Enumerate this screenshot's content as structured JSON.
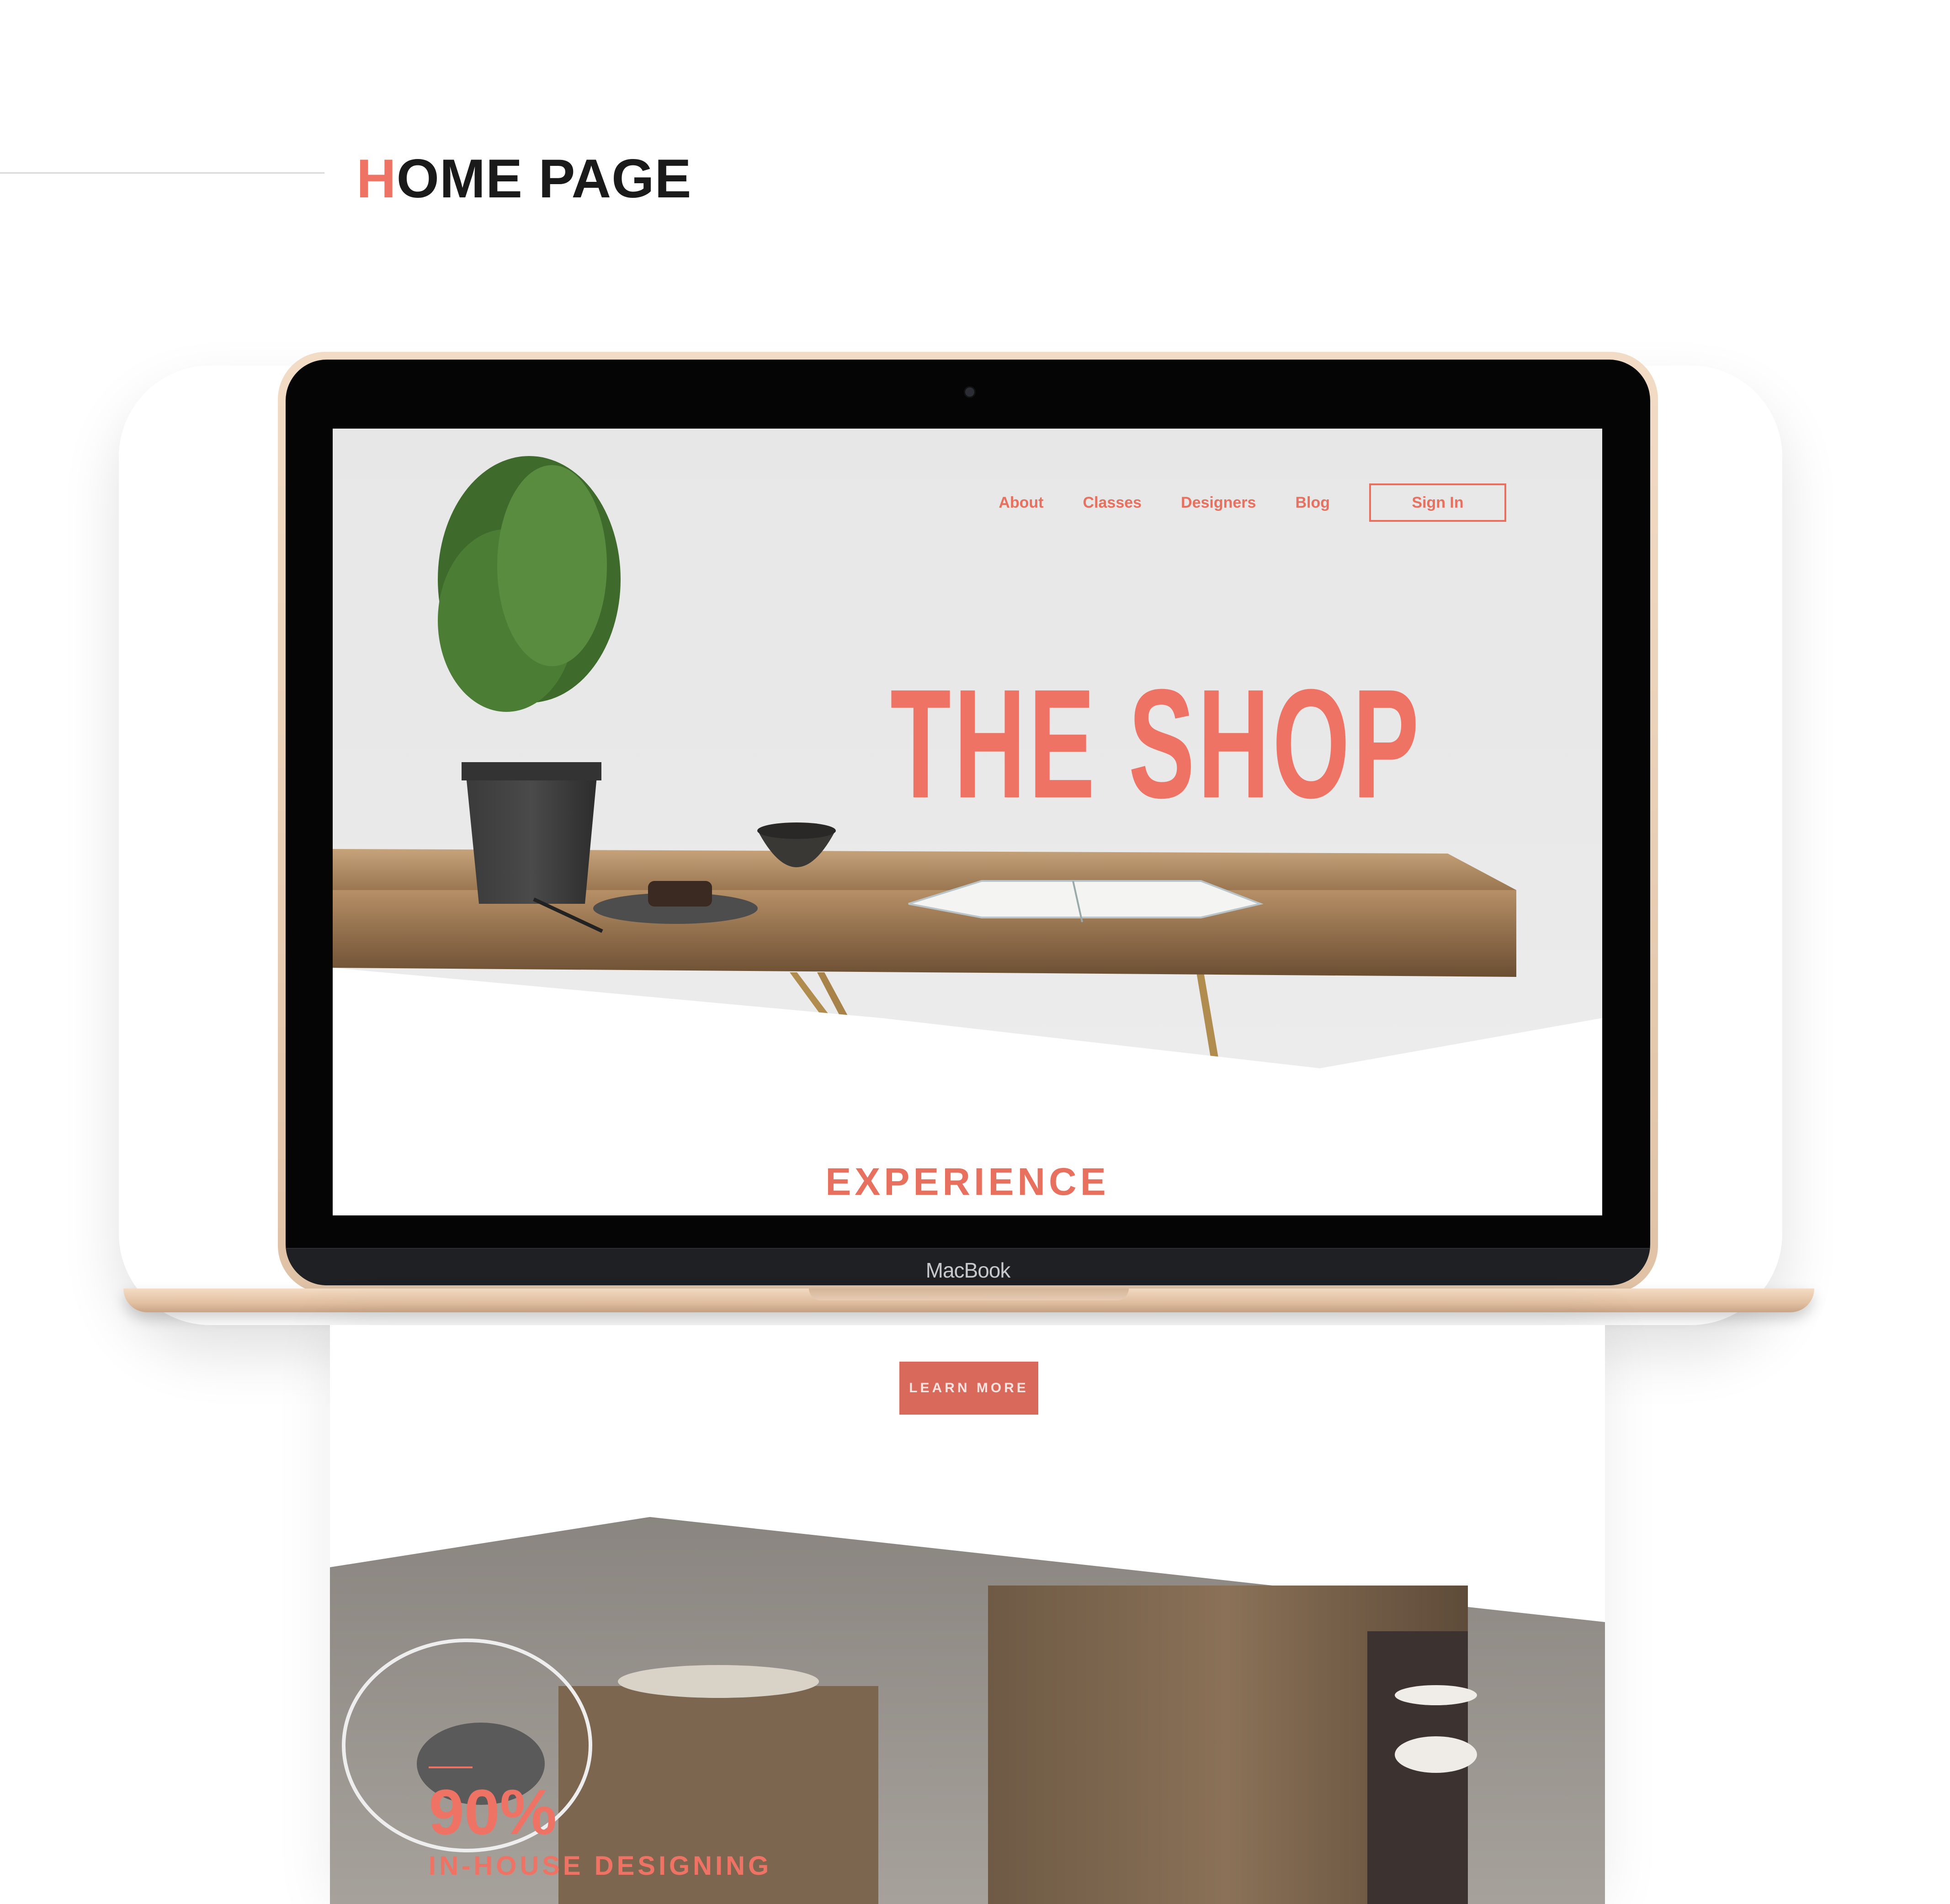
{
  "section": {
    "heading_first_letter": "H",
    "heading_rest": "OME PAGE"
  },
  "device": {
    "brand": "MacBook"
  },
  "site": {
    "nav": [
      "About",
      "Classes",
      "Designers",
      "Blog"
    ],
    "sign_in": "Sign In",
    "hero_title": "THE SHOP",
    "section_label": "EXPERIENCE",
    "cta": "LEARN MORE",
    "stat": {
      "value": "90%",
      "label": "IN-HOUSE DESIGNING"
    }
  },
  "colors": {
    "accent": "#ee7364",
    "button": "#d9695b",
    "laptop_gold": "#e0c2a6",
    "bezel": "#050505"
  }
}
